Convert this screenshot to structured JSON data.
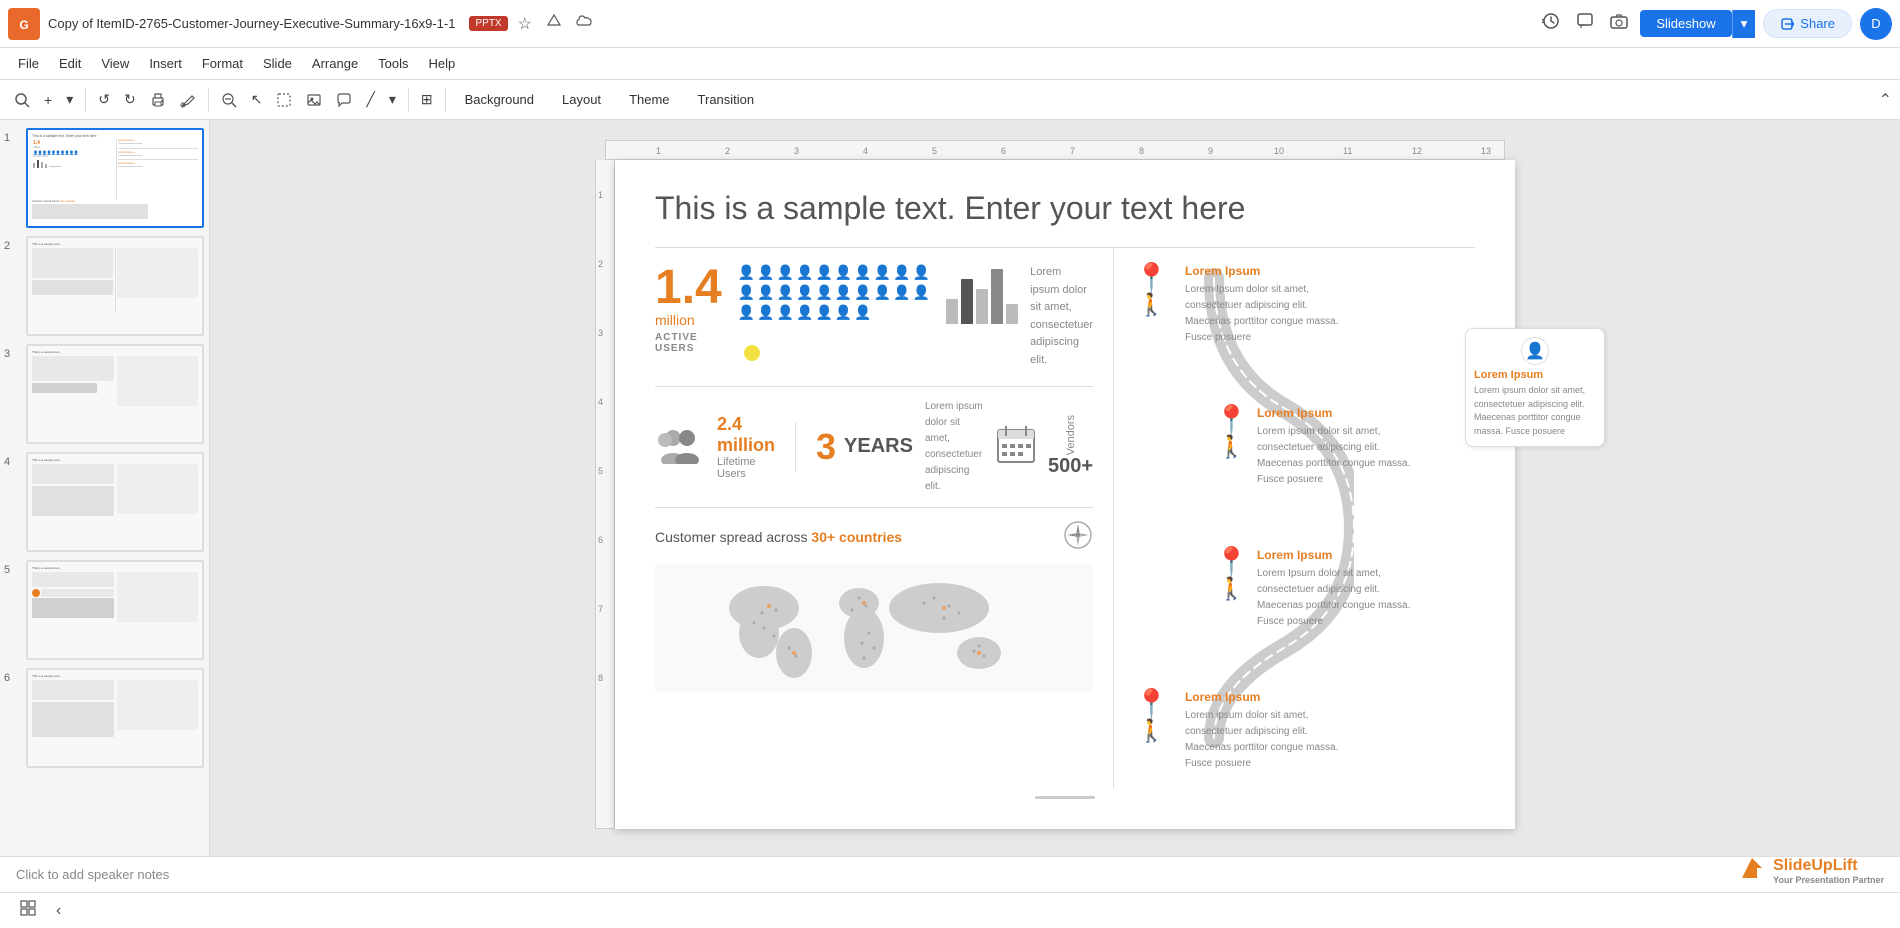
{
  "app": {
    "logo": "G",
    "title": "Copy of ItemID-2765-Customer-Journey-Executive-Summary-16x9-1-1",
    "file_type": "PPTX"
  },
  "topbar": {
    "history_icon": "↺",
    "comment_icon": "💬",
    "camera_icon": "📷",
    "slideshow_label": "Slideshow",
    "share_label": "Share",
    "user_initial": "D",
    "star_icon": "☆",
    "drive_icon": "△"
  },
  "menu": {
    "items": [
      "File",
      "Edit",
      "View",
      "Insert",
      "Format",
      "Slide",
      "Arrange",
      "Tools",
      "Help"
    ]
  },
  "toolbar": {
    "background_label": "Background",
    "layout_label": "Layout",
    "theme_label": "Theme",
    "transition_label": "Transition"
  },
  "slide_panel": {
    "slides": [
      {
        "num": "1",
        "active": true
      },
      {
        "num": "2",
        "active": false
      },
      {
        "num": "3",
        "active": false
      },
      {
        "num": "4",
        "active": false
      },
      {
        "num": "5",
        "active": false
      },
      {
        "num": "6",
        "active": false
      }
    ]
  },
  "slide": {
    "title": "This is a sample text. Enter your text here",
    "active_users": {
      "number": "1.4",
      "unit": "million",
      "label": "ACTIVE USERS",
      "people_rows": 3
    },
    "bar_chart": {
      "description": "Lorem ipsum dolor sit amet,\nconsectetuer adipiscing elit."
    },
    "lifetime": {
      "number": "2.4 million",
      "label": "Lifetime Users"
    },
    "years": {
      "number": "3",
      "text": "YEARS",
      "description": "Lorem ipsum dolor sit amet,\nconsectetuer\nadipiscing elit."
    },
    "vendors": {
      "number": "500+",
      "label": "Vendors"
    },
    "countries": {
      "prefix": "Customer spread across",
      "highlight": "30+ countries"
    },
    "journey": {
      "items": [
        {
          "title": "Lorem Ipsum",
          "desc": "Lorem Ipsum dolor sit amet, consectetuer adipiscing elit. Maecenas porttitor congue massa. Fusce posuere"
        },
        {
          "title": "Lorem Ipsum",
          "desc": "Lorem ipsum dolor sit amet, consectetuer adipiscing elit. Maecenas porttitor congue massa. Fusce posuere"
        },
        {
          "title": "Lorem Ipsum",
          "desc": "Lorem Ipsum dolor sit amet, consectetuer adipiscing elit. Maecenas porttitor congue massa. Fusce posuere"
        },
        {
          "title": "Lorem Ipsum",
          "desc": "Lorem ipsum dolor sit amet, consectetuer adipiscing elit. Maecenas porttitor congue massa. Fusce posuere"
        }
      ]
    },
    "floating_card": {
      "title": "Lorem Ipsum",
      "desc": "Lorem ipsum dolor sit amet, consectetuer adipiscing elit. Maecenas porttitor congue massa. Fusce posuere"
    }
  },
  "notes": {
    "placeholder": "Click to add speaker notes"
  },
  "watermark": {
    "brand": "SlideUpLift",
    "tagline": "Your Presentation Partner"
  },
  "colors": {
    "orange": "#e67e22",
    "blue": "#1a73e8",
    "dark_gray": "#555555",
    "light_gray": "#888888"
  }
}
